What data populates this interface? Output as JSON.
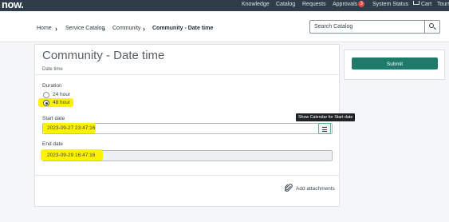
{
  "topbar": {
    "logo": "now.",
    "nav": [
      "Knowledge",
      "Catalog",
      "Requests",
      "Approvals",
      "System Status",
      "Cart",
      "Tours"
    ],
    "approvals_count": "3"
  },
  "breadcrumb": {
    "items": [
      "Home",
      "Service Catalog",
      "Community",
      "Community - Date time"
    ]
  },
  "search": {
    "placeholder": "Search Catalog"
  },
  "form": {
    "title": "Community - Date time",
    "subtitle": "Date time",
    "duration_label": "Duration",
    "duration_options": [
      "24 hour",
      "48 hour"
    ],
    "duration_selected": "48 hour",
    "start_label": "Start date",
    "start_value": "2023-09-27 23:47:16",
    "end_label": "End date",
    "end_value": "2023-09-29 16:47:16",
    "calendar_tooltip": "Show Calendar for Start date",
    "attach_label": "Add attachments"
  },
  "side": {
    "submit_label": "Submit"
  },
  "colors": {
    "topbar": "#2e3d49",
    "submit": "#1f7a69",
    "highlight": "#fff200",
    "badge": "#e8453c",
    "calendar_focus": "#58b888"
  },
  "icons": [
    "search-icon",
    "chevron-right-icon",
    "calendar-icon",
    "paperclip-icon",
    "cart-icon"
  ]
}
